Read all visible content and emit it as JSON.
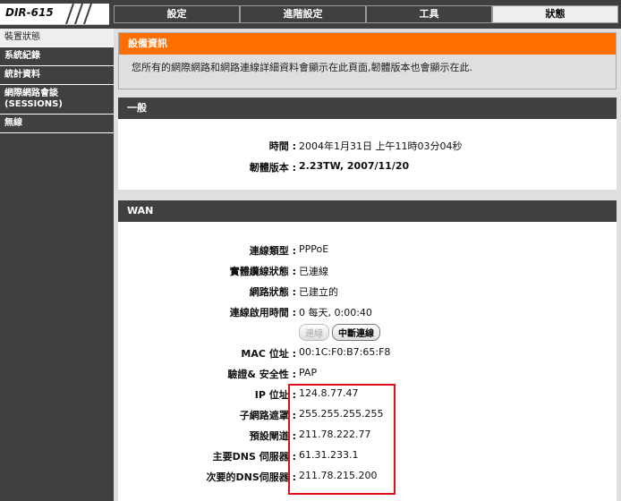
{
  "header": {
    "model": "DIR-615",
    "tabs": [
      {
        "label": "設定",
        "active": false
      },
      {
        "label": "進階設定",
        "active": false
      },
      {
        "label": "工具",
        "active": false
      },
      {
        "label": "狀態",
        "active": true
      }
    ]
  },
  "sidebar": {
    "items": [
      {
        "label": "裝置狀態",
        "active": true
      },
      {
        "label": "系統紀錄",
        "active": false
      },
      {
        "label": "統計資料",
        "active": false
      },
      {
        "label": "網際網路會談 (SESSIONS)",
        "active": false
      },
      {
        "label": "無線",
        "active": false
      }
    ]
  },
  "info": {
    "title": "設備資訊",
    "description": "您所有的網際網路和網路連線詳細資料會顯示在此頁面,韌體版本也會顯示在此."
  },
  "general": {
    "title": "一般",
    "time_label": "時間 :",
    "time_value": "2004年1月31日 上午11時03分04秒",
    "firmware_label": "韌體版本 :",
    "firmware_value": "2.23TW,  2007/11/20"
  },
  "wan": {
    "title": "WAN",
    "connection_type_label": "連線類型 :",
    "connection_type_value": "PPPoE",
    "cable_status_label": "實體纜線狀態 :",
    "cable_status_value": "已連線",
    "network_status_label": "網路狀態 :",
    "network_status_value": "已建立的",
    "uptime_label": "連線啟用時間 :",
    "uptime_value": "0 每天, 0:00:40",
    "connect_button": "連線",
    "disconnect_button": "中斷連線",
    "mac_label": "MAC 位址 :",
    "mac_value": "00:1C:F0:B7:65:F8",
    "auth_label": "驗證& 安全性 :",
    "auth_value": "PAP",
    "ip_label": "IP 位址 :",
    "ip_value": "124.8.77.47",
    "subnet_label": "子網路遮罩 :",
    "subnet_value": "255.255.255.255",
    "gateway_label": "預設閘道 :",
    "gateway_value": "211.78.222.77",
    "dns1_label": "主要DNS 伺服器 :",
    "dns1_value": "61.31.233.1",
    "dns2_label": "次要的DNS伺服器 :",
    "dns2_value": "211.78.215.200"
  },
  "colors": {
    "info_header": "#ff6f00",
    "highlight_border": "#e0101a"
  }
}
